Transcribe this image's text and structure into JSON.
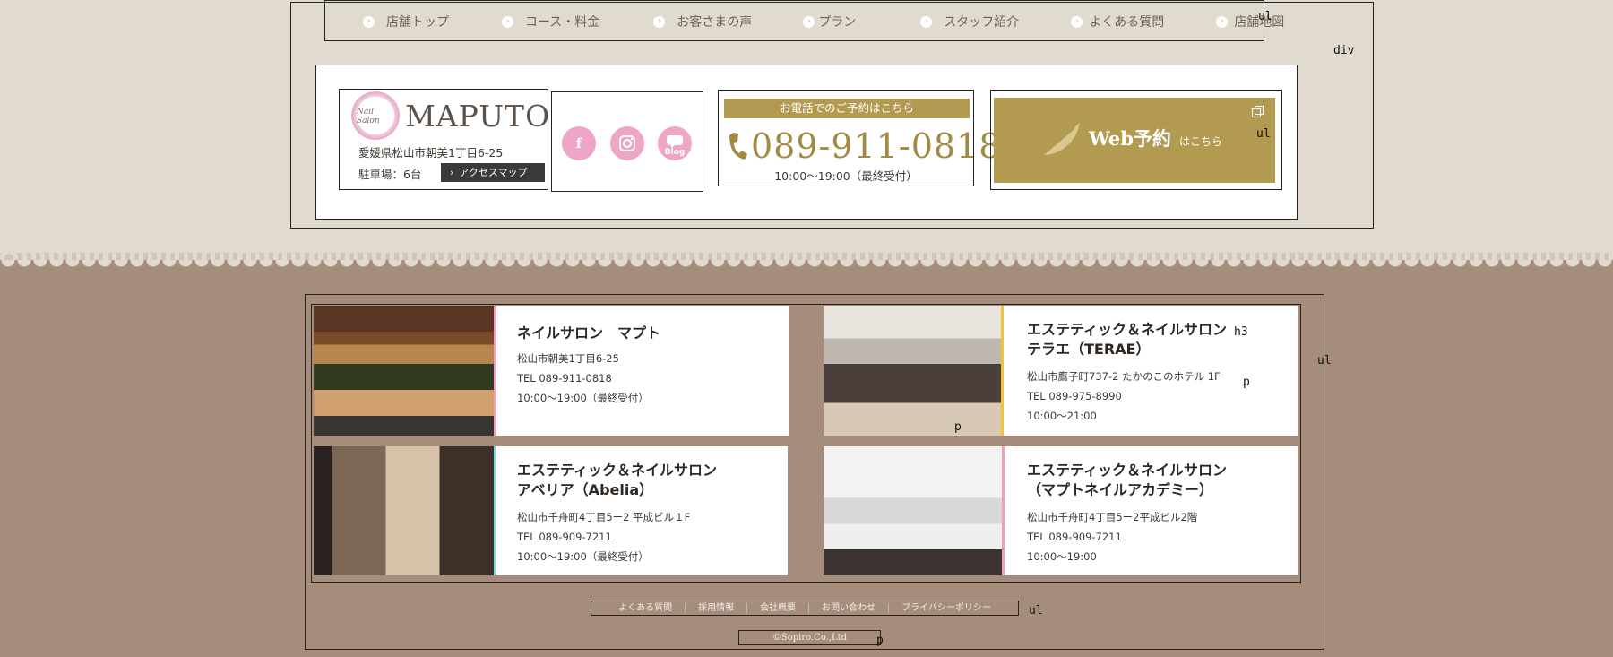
{
  "nav": {
    "items": [
      {
        "label": "店舗トップ"
      },
      {
        "label": "コース・料金"
      },
      {
        "label": "お客さまの声"
      },
      {
        "label": "プラン"
      },
      {
        "label": "スタッフ紹介"
      },
      {
        "label": "よくある質問"
      },
      {
        "label": "店舗地図"
      }
    ],
    "bullet": "›"
  },
  "header": {
    "logo": {
      "script": "Nail Salon",
      "name": "MAPUTO"
    },
    "address": "愛媛県松山市朝美1丁目6-25",
    "parking": "駐車場：6台",
    "access_button": "アクセスマップ",
    "sns": {
      "facebook": "f",
      "instagram": "instagram-icon",
      "blog": "Blog"
    },
    "tel_heading": "お電話でのご予約はこちら",
    "tel_number": "089-911-0818",
    "hours": "10:00〜19:00（最終受付）",
    "web_label": "Web予約",
    "web_suffix": "はこちら"
  },
  "debug_labels": {
    "ul": "ul",
    "div": "div",
    "h3": "h3",
    "p": "p"
  },
  "shops": [
    {
      "name": "ネイルサロン　マプト",
      "address": "松山市朝美1丁目6-25",
      "tel": "TEL 089-911-0818",
      "hours": "10:00〜19:00（最終受付）",
      "accent": "#ef9fc2"
    },
    {
      "name": "エステティック＆ネイルサロン\nテラエ（TERAE）",
      "address": "松山市鷹子町737-2 たかのこのホテル 1F",
      "tel": "TEL 089-975-8990",
      "hours": "10:00〜21:00",
      "accent": "#f1c23e"
    },
    {
      "name": "エステティック＆ネイルサロン\nアベリア（Abelia）",
      "address": "松山市千舟町4丁目5ー2 平成ビル１F",
      "tel": "TEL 089-909-7211",
      "hours": "10:00〜19:00（最終受付）",
      "accent": "#7fd6da"
    },
    {
      "name": "エステティック＆ネイルサロン\n（マプトネイルアカデミー）",
      "address": "松山市千舟町4丁目5ー2平成ビル2階",
      "tel": "TEL 089-909-7211",
      "hours": "10:00〜19:00",
      "accent": "#ef9fc2"
    }
  ],
  "footer": {
    "links": [
      {
        "label": "よくある質問"
      },
      {
        "label": "採用情報"
      },
      {
        "label": "会社概要"
      },
      {
        "label": "お問い合わせ"
      },
      {
        "label": "プライバシーポリシー"
      }
    ],
    "copyright": "©Sopiro.Co.,Ltd"
  }
}
